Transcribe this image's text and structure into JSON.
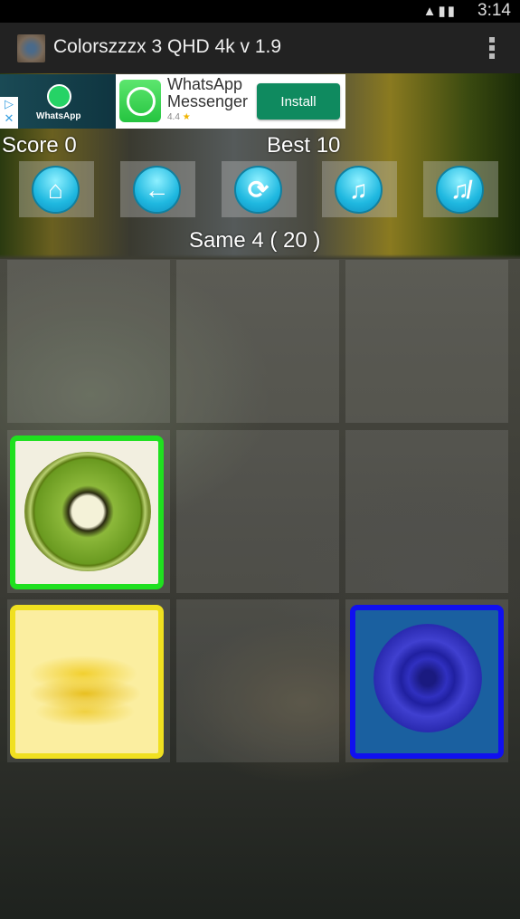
{
  "status_bar": {
    "time": "3:14",
    "icons": [
      "wifi-icon",
      "signal-icon",
      "battery-charging-icon"
    ]
  },
  "app_bar": {
    "title": "Colorszzzx 3 QHD 4k v 1.9"
  },
  "ad": {
    "brand_label": "WhatsApp",
    "title_line1": "WhatsApp",
    "title_line2": "Messenger",
    "rating": "4.4",
    "install_label": "Install"
  },
  "game": {
    "score": "Score 0",
    "best": "Best 10",
    "same": "Same 4 ( 20 )",
    "toolbar": [
      "home-icon",
      "back-arrow-icon",
      "refresh-icon",
      "music-on-icon",
      "music-off-icon"
    ],
    "cards": [
      {
        "row": 2,
        "col": 1,
        "image": "kiwi",
        "border": "#1fe01f"
      },
      {
        "row": 3,
        "col": 1,
        "image": "banana",
        "border": "#f0e020"
      },
      {
        "row": 3,
        "col": 3,
        "image": "blue-rose",
        "border": "#1010f0"
      }
    ]
  }
}
